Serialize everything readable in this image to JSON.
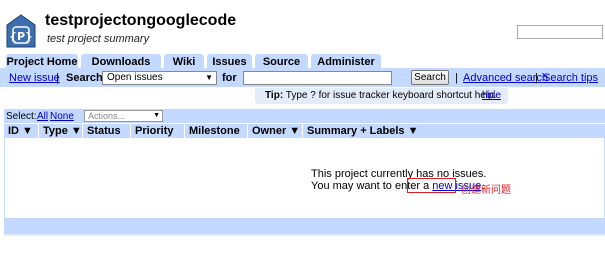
{
  "project": {
    "name": "testprojectongooglecode",
    "summary": "test project summary",
    "logo_icon": "project-logo-icon"
  },
  "tabs": [
    {
      "label": "Project Home"
    },
    {
      "label": "Downloads"
    },
    {
      "label": "Wiki"
    },
    {
      "label": "Issues"
    },
    {
      "label": "Source"
    },
    {
      "label": "Administer"
    }
  ],
  "issuebar": {
    "new_issue": "New issue",
    "sep": "|",
    "search_label": "Search",
    "scope_value": "Open issues",
    "for_label": "for",
    "search_button": "Search",
    "advanced": "Advanced search",
    "tips": "Search tips"
  },
  "tip": {
    "prefix": "Tip:",
    "text": "Type ? for issue tracker keyboard shortcut help.",
    "hide": "hide"
  },
  "selectbar": {
    "select_label": "Select:",
    "all": "All",
    "none": "None",
    "actions_placeholder": "Actions..."
  },
  "columns": [
    {
      "label": "ID ▼"
    },
    {
      "label": "Type ▼"
    },
    {
      "label": "Status ▼"
    },
    {
      "label": "Priority ▼"
    },
    {
      "label": "Milestone ▼"
    },
    {
      "label": "Owner ▼"
    },
    {
      "label": "Summary + Labels ▼"
    }
  ],
  "empty": {
    "line1": "This project currently has no issues.",
    "line2_prefix": "You may want to enter a",
    "link": "new issue",
    "line2_suffix": "."
  },
  "annotation": "创建新问题",
  "colors": {
    "bar": "#c3d9ff",
    "link": "#0000cc",
    "annotation": "#e02020"
  }
}
